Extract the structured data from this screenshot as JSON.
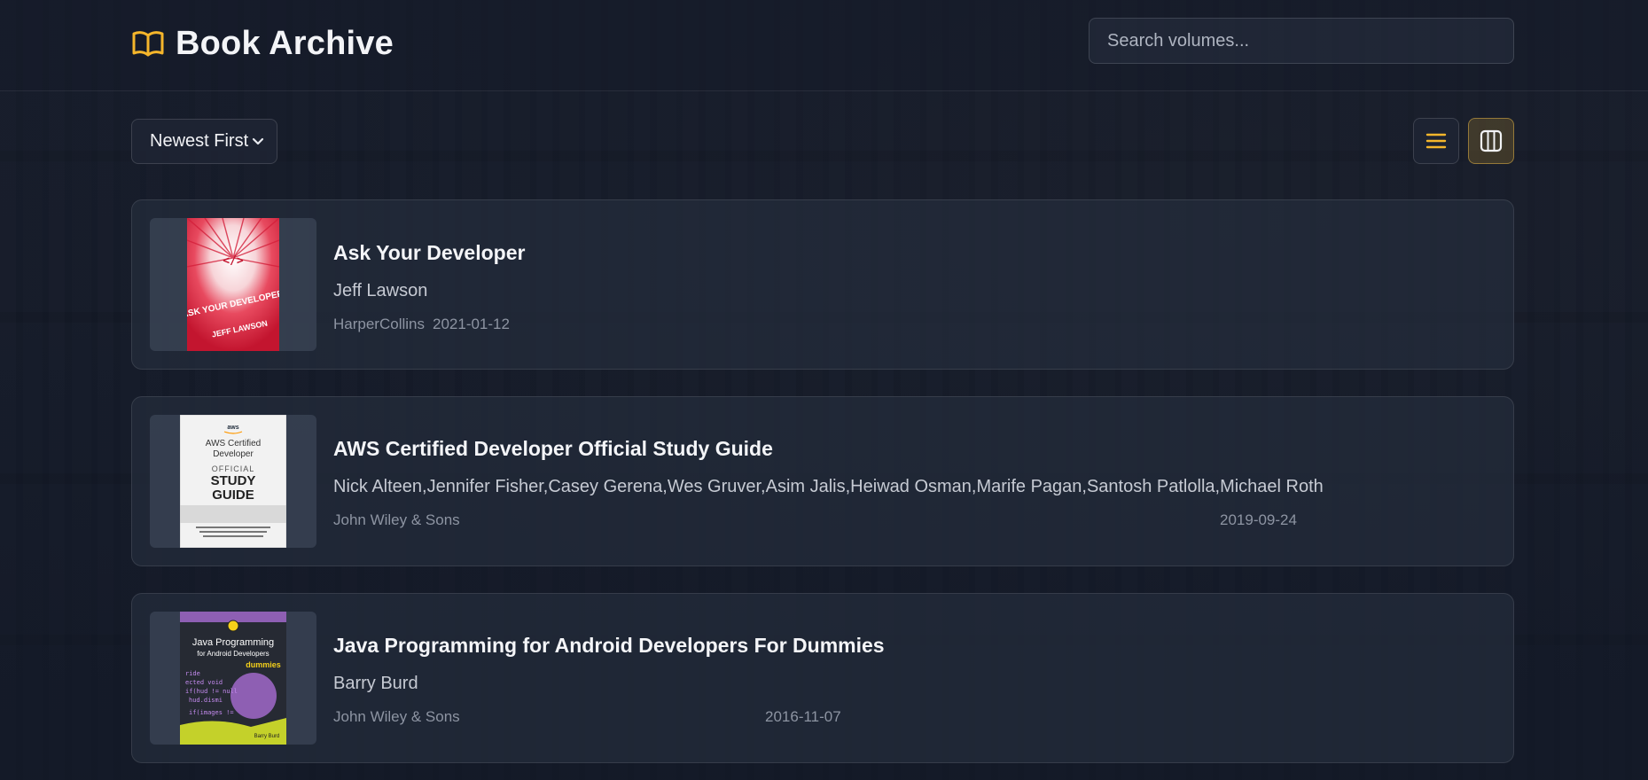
{
  "header": {
    "title": "Book Archive",
    "icon": "open-book-icon",
    "accent_color": "#f5b62b"
  },
  "search": {
    "placeholder": "Search volumes...",
    "value": ""
  },
  "toolbar": {
    "sort_selected": "Newest First",
    "view_buttons": [
      {
        "name": "list-view",
        "icon": "list-icon",
        "active": false
      },
      {
        "name": "grid-view",
        "icon": "columns-icon",
        "active": true
      }
    ]
  },
  "books": [
    {
      "title": "Ask Your Developer",
      "authors": "Jeff Lawson",
      "publisher": "HarperCollins",
      "date": "2021-01-12",
      "cover_text": [
        "ASK YOUR DEVELOPER",
        "JEFF LAWSON",
        "</>"
      ]
    },
    {
      "title": "AWS Certified Developer Official Study Guide",
      "authors": "Nick Alteen,Jennifer Fisher,Casey Gerena,Wes Gruver,Asim Jalis,Heiwad Osman,Marife Pagan,Santosh Patlolla,Michael Roth",
      "publisher": "John Wiley & Sons",
      "date": "2019-09-24",
      "cover_text": [
        "aws",
        "AWS Certified",
        "Developer",
        "OFFICIAL",
        "STUDY",
        "GUIDE"
      ]
    },
    {
      "title": "Java Programming for Android Developers For Dummies",
      "authors": "Barry Burd",
      "publisher": "John Wiley & Sons",
      "date": "2016-11-07",
      "cover_text": [
        "Java Programming",
        "for Android Developers",
        "dummies",
        "Barry Burd"
      ]
    }
  ]
}
